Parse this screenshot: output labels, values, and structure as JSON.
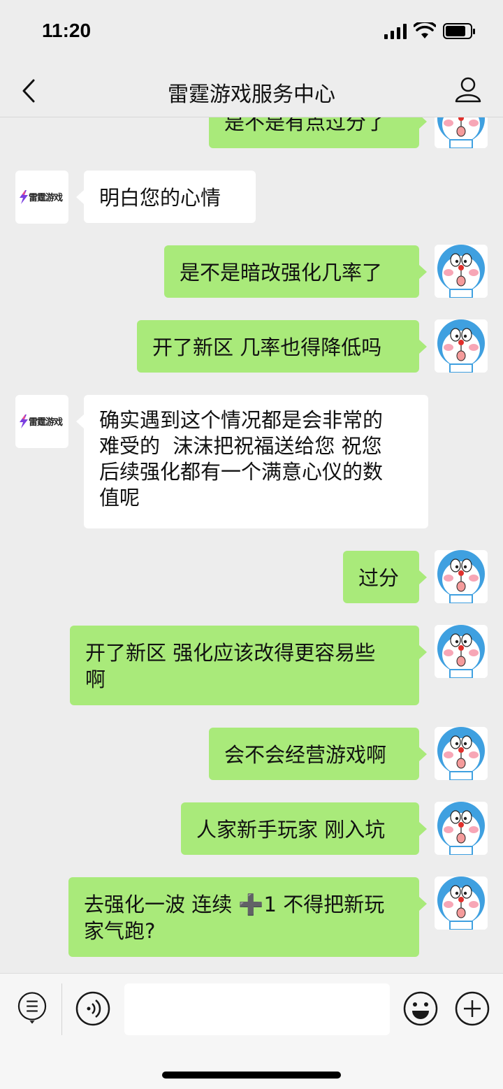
{
  "status_bar": {
    "time": "11:20"
  },
  "header": {
    "title": "雷霆游戏服务中心"
  },
  "service": {
    "logo_text": "雷霆游戏"
  },
  "messages": [
    {
      "from": "me",
      "text": "是不是有点过分了"
    },
    {
      "from": "service",
      "text": "明白您的心情"
    },
    {
      "from": "me",
      "text": "是不是暗改强化几率了"
    },
    {
      "from": "me",
      "text": "开了新区 几率也得降低吗"
    },
    {
      "from": "service",
      "lines": [
        "确实遇到这个情况都是会非常的",
        "难受的  沫沫把祝福送给您 祝您",
        "后续强化都有一个满意心仪的数",
        "值呢"
      ]
    },
    {
      "from": "me",
      "text": "过分"
    },
    {
      "from": "me",
      "lines": [
        "开了新区 强化应该改得更容易些",
        "啊"
      ]
    },
    {
      "from": "me",
      "text": "会不会经营游戏啊"
    },
    {
      "from": "me",
      "text": "人家新手玩家 刚入坑"
    },
    {
      "from": "me",
      "lines": [
        "去强化一波 连续 ➕1 不得把新玩",
        "家气跑?"
      ]
    }
  ],
  "colors": {
    "my_bubble": "#a9ea7a",
    "their_bubble": "#ffffff",
    "background": "#ededed"
  }
}
